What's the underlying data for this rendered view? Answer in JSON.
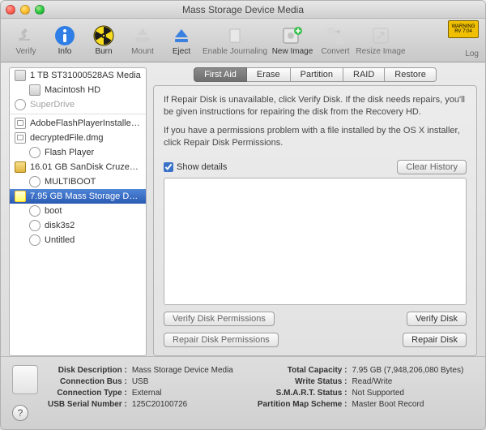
{
  "window": {
    "title": "Mass Storage Device Media"
  },
  "toolbar": {
    "items": [
      {
        "label": "Verify",
        "enabled": false
      },
      {
        "label": "Info",
        "enabled": true
      },
      {
        "label": "Burn",
        "enabled": true
      },
      {
        "label": "Mount",
        "enabled": false
      },
      {
        "label": "Eject",
        "enabled": true
      },
      {
        "label": "Enable Journaling",
        "enabled": false
      },
      {
        "label": "New Image",
        "enabled": true
      },
      {
        "label": "Convert",
        "enabled": false
      },
      {
        "label": "Resize Image",
        "enabled": false
      }
    ],
    "log_label": "Log"
  },
  "sidebar": {
    "items": [
      {
        "label": "1 TB ST31000528AS Media",
        "kind": "hdd",
        "indent": 0
      },
      {
        "label": "Macintosh HD",
        "kind": "hdd",
        "indent": 1
      },
      {
        "label": "SuperDrive",
        "kind": "disc",
        "indent": 0,
        "disabled": true
      },
      {
        "sep": true
      },
      {
        "label": "AdobeFlashPlayerInstalle…",
        "kind": "dmg",
        "indent": 0
      },
      {
        "label": "decryptedFile.dmg",
        "kind": "dmg",
        "indent": 0
      },
      {
        "label": "Flash Player",
        "kind": "ext",
        "indent": 1
      },
      {
        "label": "16.01 GB SanDisk Cruze…",
        "kind": "hdd-y",
        "indent": 0
      },
      {
        "label": "MULTIBOOT",
        "kind": "ext",
        "indent": 1
      },
      {
        "label": "7.95 GB Mass Storage D…",
        "kind": "hdd-y",
        "indent": 0,
        "selected": true
      },
      {
        "label": "boot",
        "kind": "ext",
        "indent": 1
      },
      {
        "label": "disk3s2",
        "kind": "ext",
        "indent": 1
      },
      {
        "label": "Untitled",
        "kind": "ext",
        "indent": 1
      }
    ]
  },
  "tabs": {
    "items": [
      "First Aid",
      "Erase",
      "Partition",
      "RAID",
      "Restore"
    ],
    "selected": 0
  },
  "panel": {
    "hint1": "If Repair Disk is unavailable, click Verify Disk. If the disk needs repairs, you'll be given instructions for repairing the disk from the Recovery HD.",
    "hint2": "If you have a permissions problem with a file installed by the OS X installer, click Repair Disk Permissions.",
    "show_details_label": "Show details",
    "show_details_checked": true,
    "clear_history_label": "Clear History",
    "verify_perm_label": "Verify Disk Permissions",
    "repair_perm_label": "Repair Disk Permissions",
    "verify_disk_label": "Verify Disk",
    "repair_disk_label": "Repair Disk"
  },
  "footer": {
    "left": {
      "disk_description_k": "Disk Description :",
      "disk_description_v": "Mass Storage Device Media",
      "connection_bus_k": "Connection Bus :",
      "connection_bus_v": "USB",
      "connection_type_k": "Connection Type :",
      "connection_type_v": "External",
      "usb_serial_k": "USB Serial Number :",
      "usb_serial_v": "125C20100726"
    },
    "right": {
      "total_capacity_k": "Total Capacity :",
      "total_capacity_v": "7.95 GB (7,948,206,080 Bytes)",
      "write_status_k": "Write Status :",
      "write_status_v": "Read/Write",
      "smart_status_k": "S.M.A.R.T. Status :",
      "smart_status_v": "Not Supported",
      "partition_map_k": "Partition Map Scheme :",
      "partition_map_v": "Master Boot Record"
    }
  }
}
